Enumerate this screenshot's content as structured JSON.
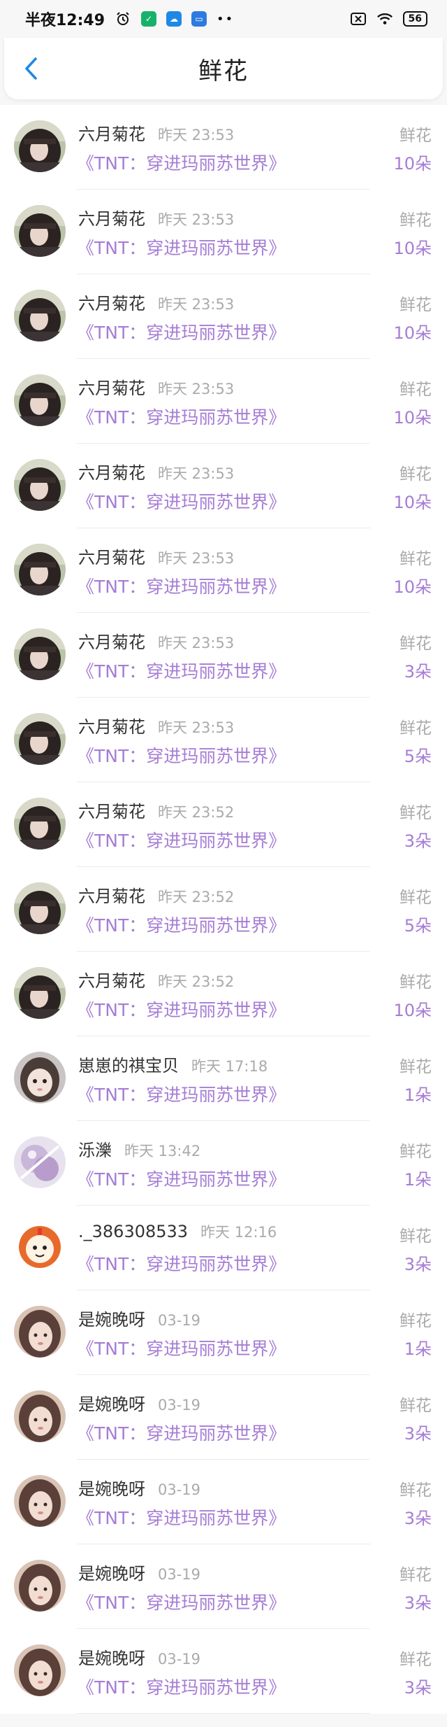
{
  "status_bar": {
    "time": "半夜12:49",
    "battery": "56"
  },
  "header": {
    "title": "鲜花"
  },
  "colors": {
    "accent": "#a67dd4",
    "back": "#1e88e5"
  },
  "items": [
    {
      "user": "六月菊花",
      "time": "昨天 23:53",
      "book": "《TNT：穿进玛丽苏世界》",
      "gift": "鲜花",
      "count": "10朵",
      "avatar": "avatar-dark-hair"
    },
    {
      "user": "六月菊花",
      "time": "昨天 23:53",
      "book": "《TNT：穿进玛丽苏世界》",
      "gift": "鲜花",
      "count": "10朵",
      "avatar": "avatar-dark-hair"
    },
    {
      "user": "六月菊花",
      "time": "昨天 23:53",
      "book": "《TNT：穿进玛丽苏世界》",
      "gift": "鲜花",
      "count": "10朵",
      "avatar": "avatar-dark-hair"
    },
    {
      "user": "六月菊花",
      "time": "昨天 23:53",
      "book": "《TNT：穿进玛丽苏世界》",
      "gift": "鲜花",
      "count": "10朵",
      "avatar": "avatar-dark-hair"
    },
    {
      "user": "六月菊花",
      "time": "昨天 23:53",
      "book": "《TNT：穿进玛丽苏世界》",
      "gift": "鲜花",
      "count": "10朵",
      "avatar": "avatar-dark-hair"
    },
    {
      "user": "六月菊花",
      "time": "昨天 23:53",
      "book": "《TNT：穿进玛丽苏世界》",
      "gift": "鲜花",
      "count": "10朵",
      "avatar": "avatar-dark-hair"
    },
    {
      "user": "六月菊花",
      "time": "昨天 23:53",
      "book": "《TNT：穿进玛丽苏世界》",
      "gift": "鲜花",
      "count": "3朵",
      "avatar": "avatar-dark-hair"
    },
    {
      "user": "六月菊花",
      "time": "昨天 23:53",
      "book": "《TNT：穿进玛丽苏世界》",
      "gift": "鲜花",
      "count": "5朵",
      "avatar": "avatar-dark-hair"
    },
    {
      "user": "六月菊花",
      "time": "昨天 23:52",
      "book": "《TNT：穿进玛丽苏世界》",
      "gift": "鲜花",
      "count": "3朵",
      "avatar": "avatar-dark-hair"
    },
    {
      "user": "六月菊花",
      "time": "昨天 23:52",
      "book": "《TNT：穿进玛丽苏世界》",
      "gift": "鲜花",
      "count": "5朵",
      "avatar": "avatar-dark-hair"
    },
    {
      "user": "六月菊花",
      "time": "昨天 23:52",
      "book": "《TNT：穿进玛丽苏世界》",
      "gift": "鲜花",
      "count": "10朵",
      "avatar": "avatar-dark-hair"
    },
    {
      "user": "崽崽的祺宝贝",
      "time": "昨天 17:18",
      "book": "《TNT：穿进玛丽苏世界》",
      "gift": "鲜花",
      "count": "1朵",
      "avatar": "avatar-child"
    },
    {
      "user": "泺濼",
      "time": "昨天 13:42",
      "book": "《TNT：穿进玛丽苏世界》",
      "gift": "鲜花",
      "count": "1朵",
      "avatar": "avatar-lavender"
    },
    {
      "user": "._386308533",
      "time": "昨天 12:16",
      "book": "《TNT：穿进玛丽苏世界》",
      "gift": "鲜花",
      "count": "3朵",
      "avatar": "avatar-cartoon-lion"
    },
    {
      "user": "是婉晚呀",
      "time": "03-19",
      "book": "《TNT：穿进玛丽苏世界》",
      "gift": "鲜花",
      "count": "1朵",
      "avatar": "avatar-girl"
    },
    {
      "user": "是婉晚呀",
      "time": "03-19",
      "book": "《TNT：穿进玛丽苏世界》",
      "gift": "鲜花",
      "count": "3朵",
      "avatar": "avatar-girl"
    },
    {
      "user": "是婉晚呀",
      "time": "03-19",
      "book": "《TNT：穿进玛丽苏世界》",
      "gift": "鲜花",
      "count": "3朵",
      "avatar": "avatar-girl"
    },
    {
      "user": "是婉晚呀",
      "time": "03-19",
      "book": "《TNT：穿进玛丽苏世界》",
      "gift": "鲜花",
      "count": "3朵",
      "avatar": "avatar-girl"
    },
    {
      "user": "是婉晚呀",
      "time": "03-19",
      "book": "《TNT：穿进玛丽苏世界》",
      "gift": "鲜花",
      "count": "3朵",
      "avatar": "avatar-girl"
    }
  ]
}
